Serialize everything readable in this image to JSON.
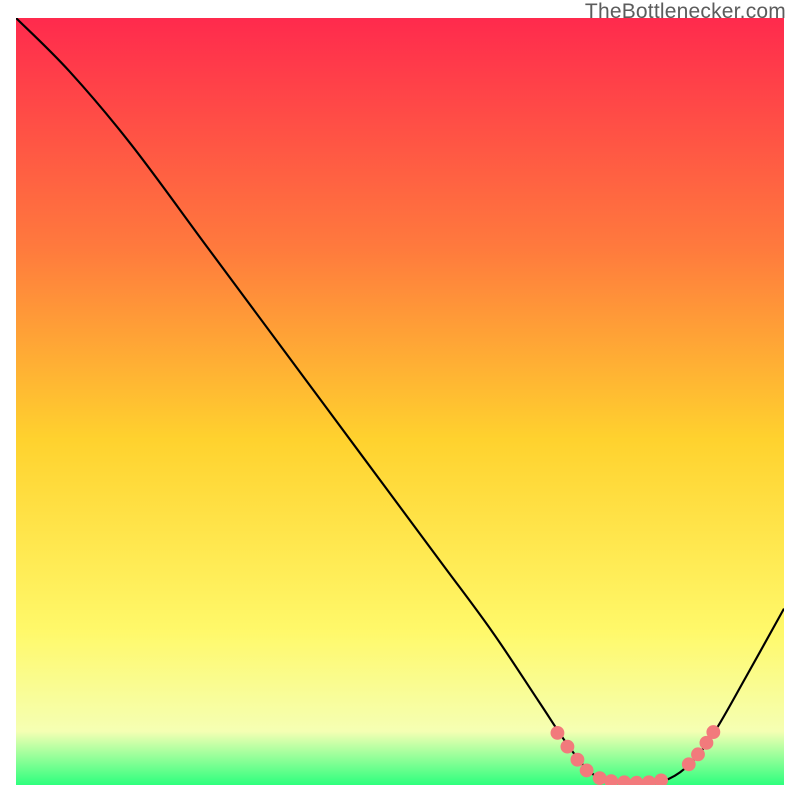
{
  "attribution": "TheBottlenecker.com",
  "colors": {
    "gradient_top": "#ff2a4d",
    "gradient_mid1": "#ff7a3d",
    "gradient_mid2": "#ffd22e",
    "gradient_mid3": "#fff96a",
    "gradient_bot1": "#f5ffb3",
    "gradient_bot2": "#2eff7e",
    "curve_stroke": "#000000",
    "marker_fill": "#f27a7c",
    "marker_stroke": "#f27a7c",
    "frame": "#ffffff"
  },
  "chart_data": {
    "type": "line",
    "title": "",
    "xlabel": "",
    "ylabel": "",
    "xlim": [
      0,
      100
    ],
    "ylim": [
      0,
      100
    ],
    "curve": [
      {
        "x": 0,
        "y": 100
      },
      {
        "x": 7,
        "y": 93
      },
      {
        "x": 15,
        "y": 83.5
      },
      {
        "x": 25,
        "y": 70
      },
      {
        "x": 35,
        "y": 56.5
      },
      {
        "x": 45,
        "y": 43
      },
      {
        "x": 55,
        "y": 29.5
      },
      {
        "x": 62,
        "y": 20
      },
      {
        "x": 68,
        "y": 11
      },
      {
        "x": 72,
        "y": 5
      },
      {
        "x": 75,
        "y": 1.5
      },
      {
        "x": 78,
        "y": 0.4
      },
      {
        "x": 82,
        "y": 0.3
      },
      {
        "x": 85,
        "y": 0.8
      },
      {
        "x": 88,
        "y": 3
      },
      {
        "x": 91,
        "y": 7
      },
      {
        "x": 95,
        "y": 14
      },
      {
        "x": 100,
        "y": 23
      }
    ],
    "markers": [
      {
        "x": 70.5,
        "y": 6.8
      },
      {
        "x": 71.8,
        "y": 5.0
      },
      {
        "x": 73.1,
        "y": 3.3
      },
      {
        "x": 74.3,
        "y": 1.9
      },
      {
        "x": 76.0,
        "y": 0.9
      },
      {
        "x": 77.5,
        "y": 0.5
      },
      {
        "x": 79.2,
        "y": 0.35
      },
      {
        "x": 80.8,
        "y": 0.3
      },
      {
        "x": 82.4,
        "y": 0.35
      },
      {
        "x": 84.0,
        "y": 0.6
      },
      {
        "x": 87.6,
        "y": 2.7
      },
      {
        "x": 88.8,
        "y": 4.0
      },
      {
        "x": 89.9,
        "y": 5.5
      },
      {
        "x": 90.8,
        "y": 6.9
      }
    ],
    "gradient_stops": [
      {
        "offset": 0.0,
        "key": "gradient_top"
      },
      {
        "offset": 0.3,
        "key": "gradient_mid1"
      },
      {
        "offset": 0.55,
        "key": "gradient_mid2"
      },
      {
        "offset": 0.8,
        "key": "gradient_mid3"
      },
      {
        "offset": 0.93,
        "key": "gradient_bot1"
      },
      {
        "offset": 1.0,
        "key": "gradient_bot2"
      }
    ]
  }
}
